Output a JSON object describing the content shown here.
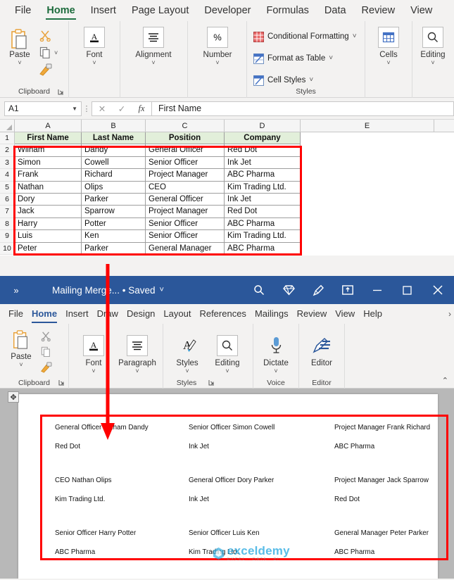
{
  "excel": {
    "tabs": [
      "File",
      "Home",
      "Insert",
      "Page Layout",
      "Developer",
      "Formulas",
      "Data",
      "Review",
      "View"
    ],
    "active_tab": "Home",
    "groups": [
      {
        "label": "Clipboard",
        "items": [
          "Paste",
          "Cut",
          "Copy",
          "Format Painter"
        ]
      },
      {
        "label": "Font",
        "items": [
          "Font"
        ]
      },
      {
        "label": "Alignment",
        "items": [
          "Alignment"
        ]
      },
      {
        "label": "Number",
        "items": [
          "Number"
        ]
      },
      {
        "label": "Styles",
        "items": [
          "Conditional Formatting",
          "Format as Table",
          "Cell Styles"
        ]
      },
      {
        "label": "Cells",
        "items": [
          "Cells"
        ]
      },
      {
        "label": "Editing",
        "items": [
          "Editing"
        ]
      }
    ],
    "buttons": {
      "paste": "Paste",
      "font": "Font",
      "alignment": "Alignment",
      "number": "Number",
      "cells": "Cells",
      "editing": "Editing",
      "conditional_formatting": "Conditional Formatting",
      "format_as_table": "Format as Table",
      "cell_styles": "Cell Styles"
    },
    "formula_bar": {
      "name_box": "A1",
      "value": "First Name",
      "fx_label": "fx",
      "cancel": "✕",
      "confirm": "✓"
    },
    "columns": [
      "A",
      "B",
      "C",
      "D",
      "E"
    ],
    "row_numbers": [
      "1",
      "2",
      "3",
      "4",
      "5",
      "6",
      "7",
      "8",
      "9",
      "10"
    ],
    "table": {
      "headers": [
        "First Name",
        "Last Name",
        "Position",
        "Company"
      ],
      "rows": [
        [
          "Wilham",
          "Dandy",
          "General Officer",
          "Red Dot"
        ],
        [
          "Simon",
          "Cowell",
          "Senior Officer",
          "Ink Jet"
        ],
        [
          "Frank",
          "Richard",
          "Project Manager",
          "ABC Pharma"
        ],
        [
          "Nathan",
          "Olips",
          "CEO",
          "Kim Trading Ltd."
        ],
        [
          "Dory",
          "Parker",
          "General Officer",
          "Ink Jet"
        ],
        [
          "Jack",
          "Sparrow",
          "Project Manager",
          "Red Dot"
        ],
        [
          "Harry",
          "Potter",
          "Senior Officer",
          "ABC Pharma"
        ],
        [
          "Luis",
          "Ken",
          "Senior Officer",
          "Kim Trading Ltd."
        ],
        [
          "Peter",
          "Parker",
          "General Manager",
          "ABC Pharma"
        ]
      ]
    },
    "header_fill": "#E2EFDA",
    "accent": "#217346",
    "highlight_box_color": "#FF0000"
  },
  "word": {
    "title_bar": {
      "chevron": "»",
      "document_name": "Mailing Merge... • Saved",
      "saved_chevron": "⌄",
      "icons": [
        "search-icon",
        "diamond-icon",
        "pen-icon",
        "ribbon-display-icon",
        "minimize-icon",
        "maximize-icon",
        "close-icon"
      ],
      "background": "#2B579A"
    },
    "tabs": [
      "File",
      "Home",
      "Insert",
      "Draw",
      "Design",
      "Layout",
      "References",
      "Mailings",
      "Review",
      "View",
      "Help"
    ],
    "active_tab": "Home",
    "tab_overflow": "›",
    "groups": [
      {
        "label": "Clipboard",
        "items": [
          "Paste",
          "Cut",
          "Copy",
          "Format Painter"
        ]
      },
      {
        "label": "",
        "items": [
          "Font",
          "Paragraph"
        ]
      },
      {
        "label": "Styles",
        "items": [
          "Styles",
          "Editing"
        ]
      },
      {
        "label": "Voice",
        "items": [
          "Dictate"
        ]
      },
      {
        "label": "Editor",
        "items": [
          "Editor"
        ]
      }
    ],
    "buttons": {
      "paste": "Paste",
      "font": "Font",
      "paragraph": "Paragraph",
      "styles": "Styles",
      "editing": "Editing",
      "dictate": "Dictate",
      "editor": "Editor"
    },
    "collapse_ribbon": "⌃",
    "document": {
      "merge_blocks": [
        {
          "line1": "General Officer Wilham Dandy",
          "line2": "Red Dot"
        },
        {
          "line1": "Senior Officer Simon Cowell",
          "line2": "Ink Jet"
        },
        {
          "line1": "Project Manager Frank Richard",
          "line2": "ABC Pharma"
        },
        {
          "line1": "CEO Nathan Olips",
          "line2": "Kim Trading Ltd."
        },
        {
          "line1": "General Officer Dory Parker",
          "line2": "Ink Jet"
        },
        {
          "line1": "Project Manager Jack Sparrow",
          "line2": "Red Dot"
        },
        {
          "line1": "Senior Officer Harry Potter",
          "line2": "ABC Pharma"
        },
        {
          "line1": "Senior Officer Luis Ken",
          "line2": "Kim Trading Ltd."
        },
        {
          "line1": "General Manager Peter Parker",
          "line2": "ABC Pharma"
        }
      ]
    },
    "move_handle": "✥",
    "highlight_box_color": "#FF0000"
  },
  "watermark": {
    "main": "exceldemy",
    "sub": "EXCEL · DATA · BI",
    "color": "#2AAAE1"
  }
}
